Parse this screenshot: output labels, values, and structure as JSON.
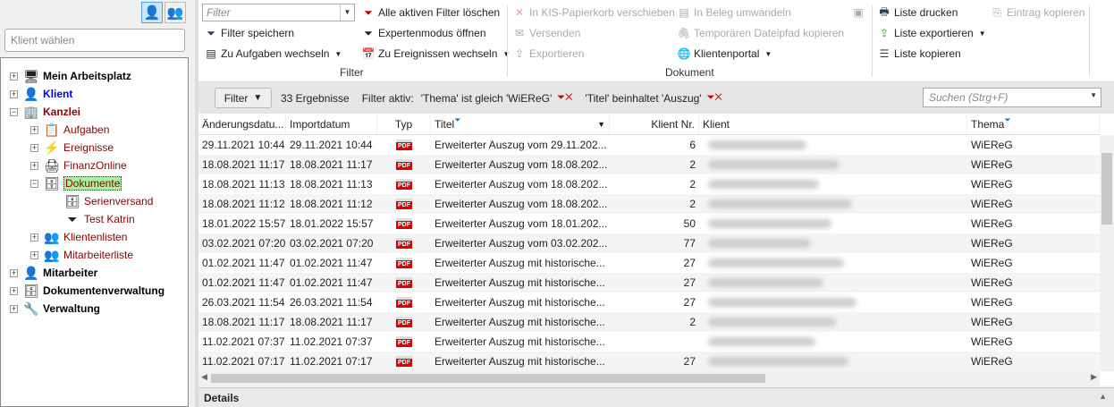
{
  "left": {
    "klient_placeholder": "Klient wählen",
    "tree": [
      {
        "label": "Mein Arbeitsplatz",
        "icon": "computer-icon",
        "level": 0,
        "style": "bold",
        "toggle": "+"
      },
      {
        "label": "Klient",
        "icon": "person-icon",
        "level": 0,
        "style": "blue",
        "toggle": "+"
      },
      {
        "label": "Kanzlei",
        "icon": "building-icon",
        "level": 0,
        "style": "darkred",
        "toggle": "−"
      },
      {
        "label": "Aufgaben",
        "icon": "notepad-icon",
        "level": 1,
        "style": "red",
        "toggle": "+"
      },
      {
        "label": "Ereignisse",
        "icon": "event-icon",
        "level": 1,
        "style": "red",
        "toggle": "+"
      },
      {
        "label": "FinanzOnline",
        "icon": "printer-icon",
        "level": 1,
        "style": "red",
        "toggle": "+"
      },
      {
        "label": "Dokumente",
        "icon": "document-cabinet-icon",
        "level": 1,
        "style": "selected",
        "toggle": "−"
      },
      {
        "label": "Serienversand",
        "icon": "document-cabinet-icon",
        "level": 2,
        "style": "red",
        "toggle": ""
      },
      {
        "label": "Test Katrin",
        "icon": "funnel-icon",
        "level": 2,
        "style": "red",
        "toggle": ""
      },
      {
        "label": "Klientenlisten",
        "icon": "people-icon",
        "level": 1,
        "style": "red",
        "toggle": "+"
      },
      {
        "label": "Mitarbeiterliste",
        "icon": "people-icon",
        "level": 1,
        "style": "red",
        "toggle": "+"
      },
      {
        "label": "Mitarbeiter",
        "icon": "employee-icon",
        "level": 0,
        "style": "bold",
        "toggle": "+"
      },
      {
        "label": "Dokumentenverwaltung",
        "icon": "document-cabinet-icon",
        "level": 0,
        "style": "bold",
        "toggle": "+"
      },
      {
        "label": "Verwaltung",
        "icon": "wrench-icon",
        "level": 0,
        "style": "bold",
        "toggle": "+"
      }
    ]
  },
  "ribbon": {
    "filter_placeholder": "Filter",
    "filter_group": "Filter",
    "dokument_group": "Dokument",
    "alle_filter_loeschen": "Alle aktiven Filter löschen",
    "filter_speichern": "Filter speichern",
    "expertenmodus": "Expertenmodus öffnen",
    "zu_aufgaben": "Zu Aufgaben wechseln",
    "zu_ereignissen": "Zu Ereignissen wechseln",
    "papierkorb": "In KIS-Papierkorb verschieben",
    "versenden": "Versenden",
    "exportieren": "Exportieren",
    "beleg": "In Beleg umwandeln",
    "dateipfad": "Temporären Dateipfad kopieren",
    "klientenportal": "Klientenportal",
    "liste_drucken": "Liste drucken",
    "liste_exportieren": "Liste exportieren",
    "liste_kopieren": "Liste kopieren",
    "eintrag_kopieren": "Eintrag kopieren"
  },
  "filterbar": {
    "button": "Filter",
    "count": "33 Ergebnisse",
    "active_label": "Filter aktiv:",
    "filter1": "'Thema' ist gleich 'WiEReG'",
    "filter2": "'Titel' beinhaltet 'Auszug'",
    "search_placeholder": "Suchen (Strg+F)"
  },
  "table": {
    "columns": [
      "Änderungsdatu...",
      "Importdatum",
      "Typ",
      "Titel",
      "Klient Nr.",
      "Klient",
      "Thema"
    ],
    "rows": [
      [
        "29.11.2021 10:44",
        "29.11.2021 10:44",
        "PDF",
        "Erweiterter Auszug vom 29.11.202...",
        "6",
        "",
        "WiEReG"
      ],
      [
        "18.08.2021 11:17",
        "18.08.2021 11:17",
        "PDF",
        "Erweiterter Auszug vom 18.08.202...",
        "2",
        "",
        "WiEReG"
      ],
      [
        "18.08.2021 11:13",
        "18.08.2021 11:13",
        "PDF",
        "Erweiterter Auszug vom 18.08.202...",
        "2",
        "",
        "WiEReG"
      ],
      [
        "18.08.2021 11:12",
        "18.08.2021 11:12",
        "PDF",
        "Erweiterter Auszug vom 18.08.202...",
        "2",
        "",
        "WiEReG"
      ],
      [
        "18.01.2022 15:57",
        "18.01.2022 15:57",
        "PDF",
        "Erweiterter Auszug vom 18.01.202...",
        "50",
        "",
        "WiEReG"
      ],
      [
        "03.02.2021 07:20",
        "03.02.2021 07:20",
        "PDF",
        "Erweiterter Auszug vom 03.02.202...",
        "77",
        "",
        "WiEReG"
      ],
      [
        "01.02.2021 11:47",
        "01.02.2021 11:47",
        "PDF",
        "Erweiterter Auszug mit historische...",
        "27",
        "",
        "WiEReG"
      ],
      [
        "01.02.2021 11:47",
        "01.02.2021 11:47",
        "PDF",
        "Erweiterter Auszug mit historische...",
        "27",
        "",
        "WiEReG"
      ],
      [
        "26.03.2021 11:54",
        "26.03.2021 11:54",
        "PDF",
        "Erweiterter Auszug mit historische...",
        "27",
        "",
        "WiEReG"
      ],
      [
        "18.08.2021 11:17",
        "18.08.2021 11:17",
        "PDF",
        "Erweiterter Auszug mit historische...",
        "2",
        "",
        "WiEReG"
      ],
      [
        "11.02.2021 07:37",
        "11.02.2021 07:37",
        "PDF",
        "Erweiterter Auszug mit historische...",
        "",
        "",
        "WiEReG"
      ],
      [
        "11.02.2021 07:17",
        "11.02.2021 07:17",
        "PDF",
        "Erweiterter Auszug mit historische...",
        "27",
        "",
        "WiEReG"
      ]
    ]
  },
  "details": "Details",
  "colors": {
    "accent": "#0078d7",
    "selected_node": "#a8f0a0",
    "tree_red": "#8b0000",
    "pdf_red": "#dd0000"
  }
}
